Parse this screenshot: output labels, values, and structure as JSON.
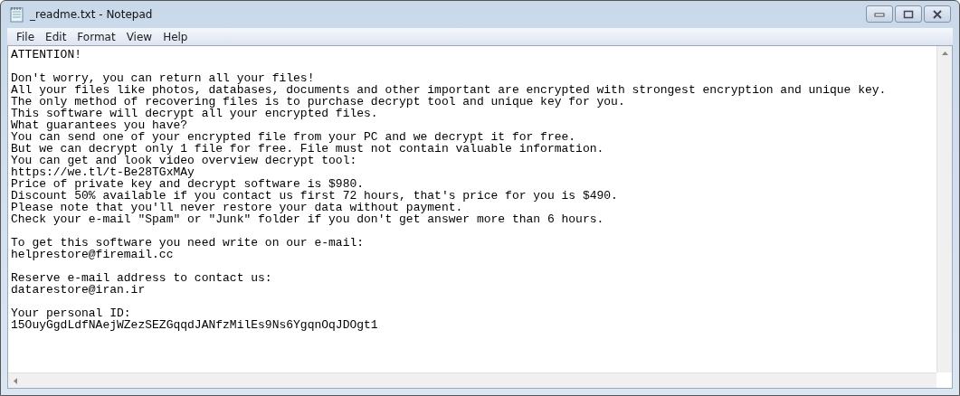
{
  "window": {
    "title": "_readme.txt - Notepad"
  },
  "menu": [
    {
      "label": "File"
    },
    {
      "label": "Edit"
    },
    {
      "label": "Format"
    },
    {
      "label": "View"
    },
    {
      "label": "Help"
    }
  ],
  "document": {
    "paragraphs": [
      {
        "lines": [
          "ATTENTION!"
        ]
      },
      {
        "lines": [
          "Don't worry, you can return all your files!",
          "All your files like photos, databases, documents and other important are encrypted with strongest encryption and unique key.",
          "The only method of recovering files is to purchase decrypt tool and unique key for you.",
          "This software will decrypt all your encrypted files.",
          "What guarantees you have?",
          "You can send one of your encrypted file from your PC and we decrypt it for free.",
          "But we can decrypt only 1 file for free. File must not contain valuable information.",
          "You can get and look video overview decrypt tool:",
          "https://we.tl/t-Be28TGxMAy",
          "Price of private key and decrypt software is $980.",
          "Discount 50% available if you contact us first 72 hours, that's price for you is $490.",
          "Please note that you'll never restore your data without payment.",
          "Check your e-mail \"Spam\" or \"Junk\" folder if you don't get answer more than 6 hours."
        ]
      },
      {
        "lines": [
          "To get this software you need write on our e-mail:",
          "helprestore@firemail.cc"
        ]
      },
      {
        "lines": [
          "Reserve e-mail address to contact us:",
          "datarestore@iran.ir"
        ]
      },
      {
        "lines": [
          "Your personal ID:",
          "15OuyGgdLdfNAejWZezSEZGqqdJANfzMilEs9Ns6YgqnOqJDOgt1"
        ]
      }
    ]
  }
}
